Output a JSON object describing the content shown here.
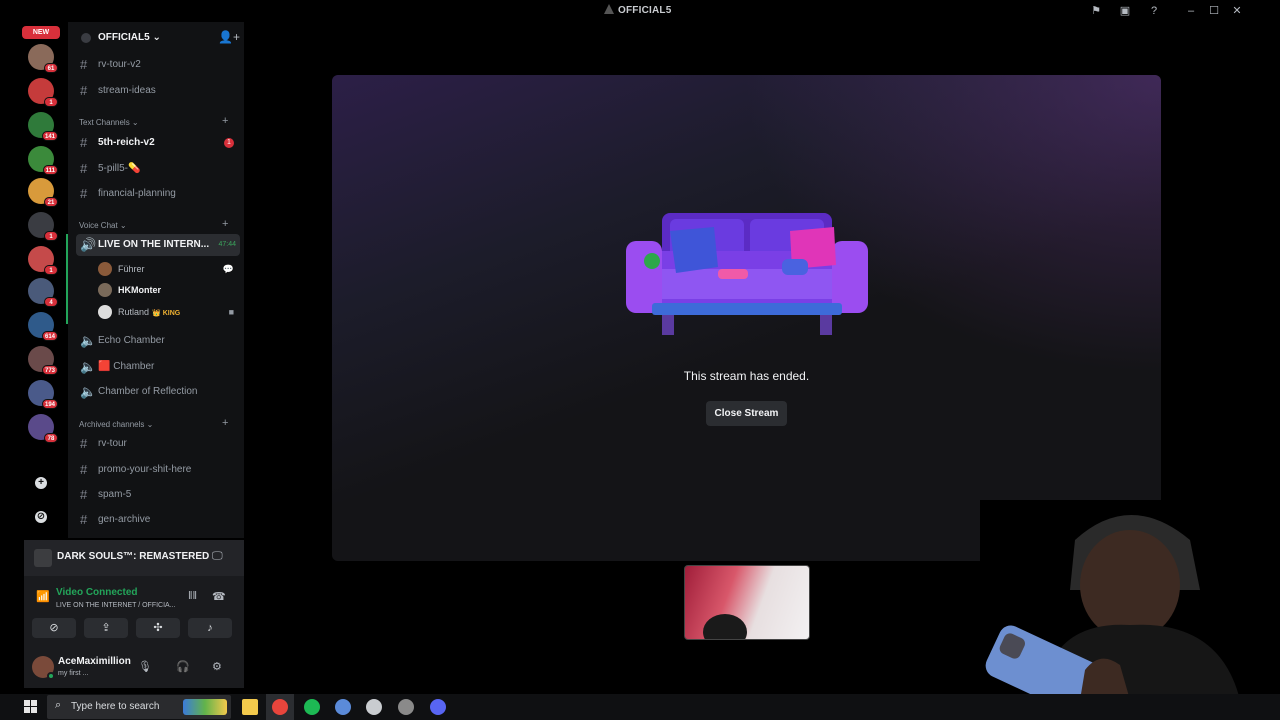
{
  "window": {
    "title": "OFFICIAL5"
  },
  "rail": {
    "new_label": "NEW",
    "servers": [
      {
        "badge": "61",
        "color": "#8a6a5a"
      },
      {
        "badge": "1",
        "color": "#c53b3b"
      },
      {
        "badge": "141",
        "color": "#2f7a3a"
      },
      {
        "badge": "111",
        "color": "#3b8a3b"
      },
      {
        "badge": "21",
        "color": "#d89a3b"
      },
      {
        "badge": "1",
        "color": "#3a3c42"
      },
      {
        "badge": "1",
        "color": "#c54a4a"
      },
      {
        "badge": "4",
        "color": "#4a5a7a"
      },
      {
        "badge": "614",
        "color": "#2f5a8a"
      },
      {
        "badge": "773",
        "color": "#6a4a4a"
      },
      {
        "badge": "194",
        "color": "#4a5a8a"
      },
      {
        "badge": "78",
        "color": "#5a4a8a"
      }
    ]
  },
  "sidebar": {
    "server_name": "OFFICIAL5",
    "top_channels": [
      "rv-tour-v2",
      "stream-ideas"
    ],
    "text_category": "Text Channels",
    "text_channels": [
      {
        "name": "5th-reich-v2",
        "unread": "1"
      },
      {
        "name": "5-pill5-💊"
      },
      {
        "name": "financial-planning"
      }
    ],
    "voice_category": "Voice Chat",
    "live_channel": {
      "name": "LIVE ON THE INTERN...",
      "time": "47:44"
    },
    "members": [
      {
        "name": "Führer",
        "color": "#8a5a3a"
      },
      {
        "name": "HKMonter",
        "color": "#7a6a5a"
      },
      {
        "name": "Rutland",
        "tag": "👑 KING",
        "color": "#dddddd"
      }
    ],
    "voice_channels": [
      "Echo Chamber",
      "🟥 Chamber",
      "Chamber of Reflection"
    ],
    "archived_category": "Archived channels",
    "archived_channels": [
      "rv-tour",
      "promo-your-shit-here",
      "spam-5",
      "gen-archive"
    ]
  },
  "activity": {
    "game": "DARK SOULS™: REMASTERED"
  },
  "voice": {
    "status": "Video Connected",
    "location": "LIVE ON THE INTERNET / OFFICIA..."
  },
  "user": {
    "name": "AceMaximillion",
    "status": "my first ..."
  },
  "stream": {
    "message": "This stream has ended.",
    "close_label": "Close Stream"
  },
  "taskbar": {
    "search_placeholder": "Type here to search",
    "apps": [
      {
        "name": "files",
        "color": "#f2c94c"
      },
      {
        "name": "chrome",
        "color": "#e8453c"
      },
      {
        "name": "spotify",
        "color": "#1db954"
      },
      {
        "name": "app",
        "color": "#5b8bd9"
      },
      {
        "name": "app2",
        "color": "#c9ccd0"
      },
      {
        "name": "game",
        "color": "#8a8a8a"
      },
      {
        "name": "discord",
        "color": "#5865f2"
      }
    ]
  }
}
